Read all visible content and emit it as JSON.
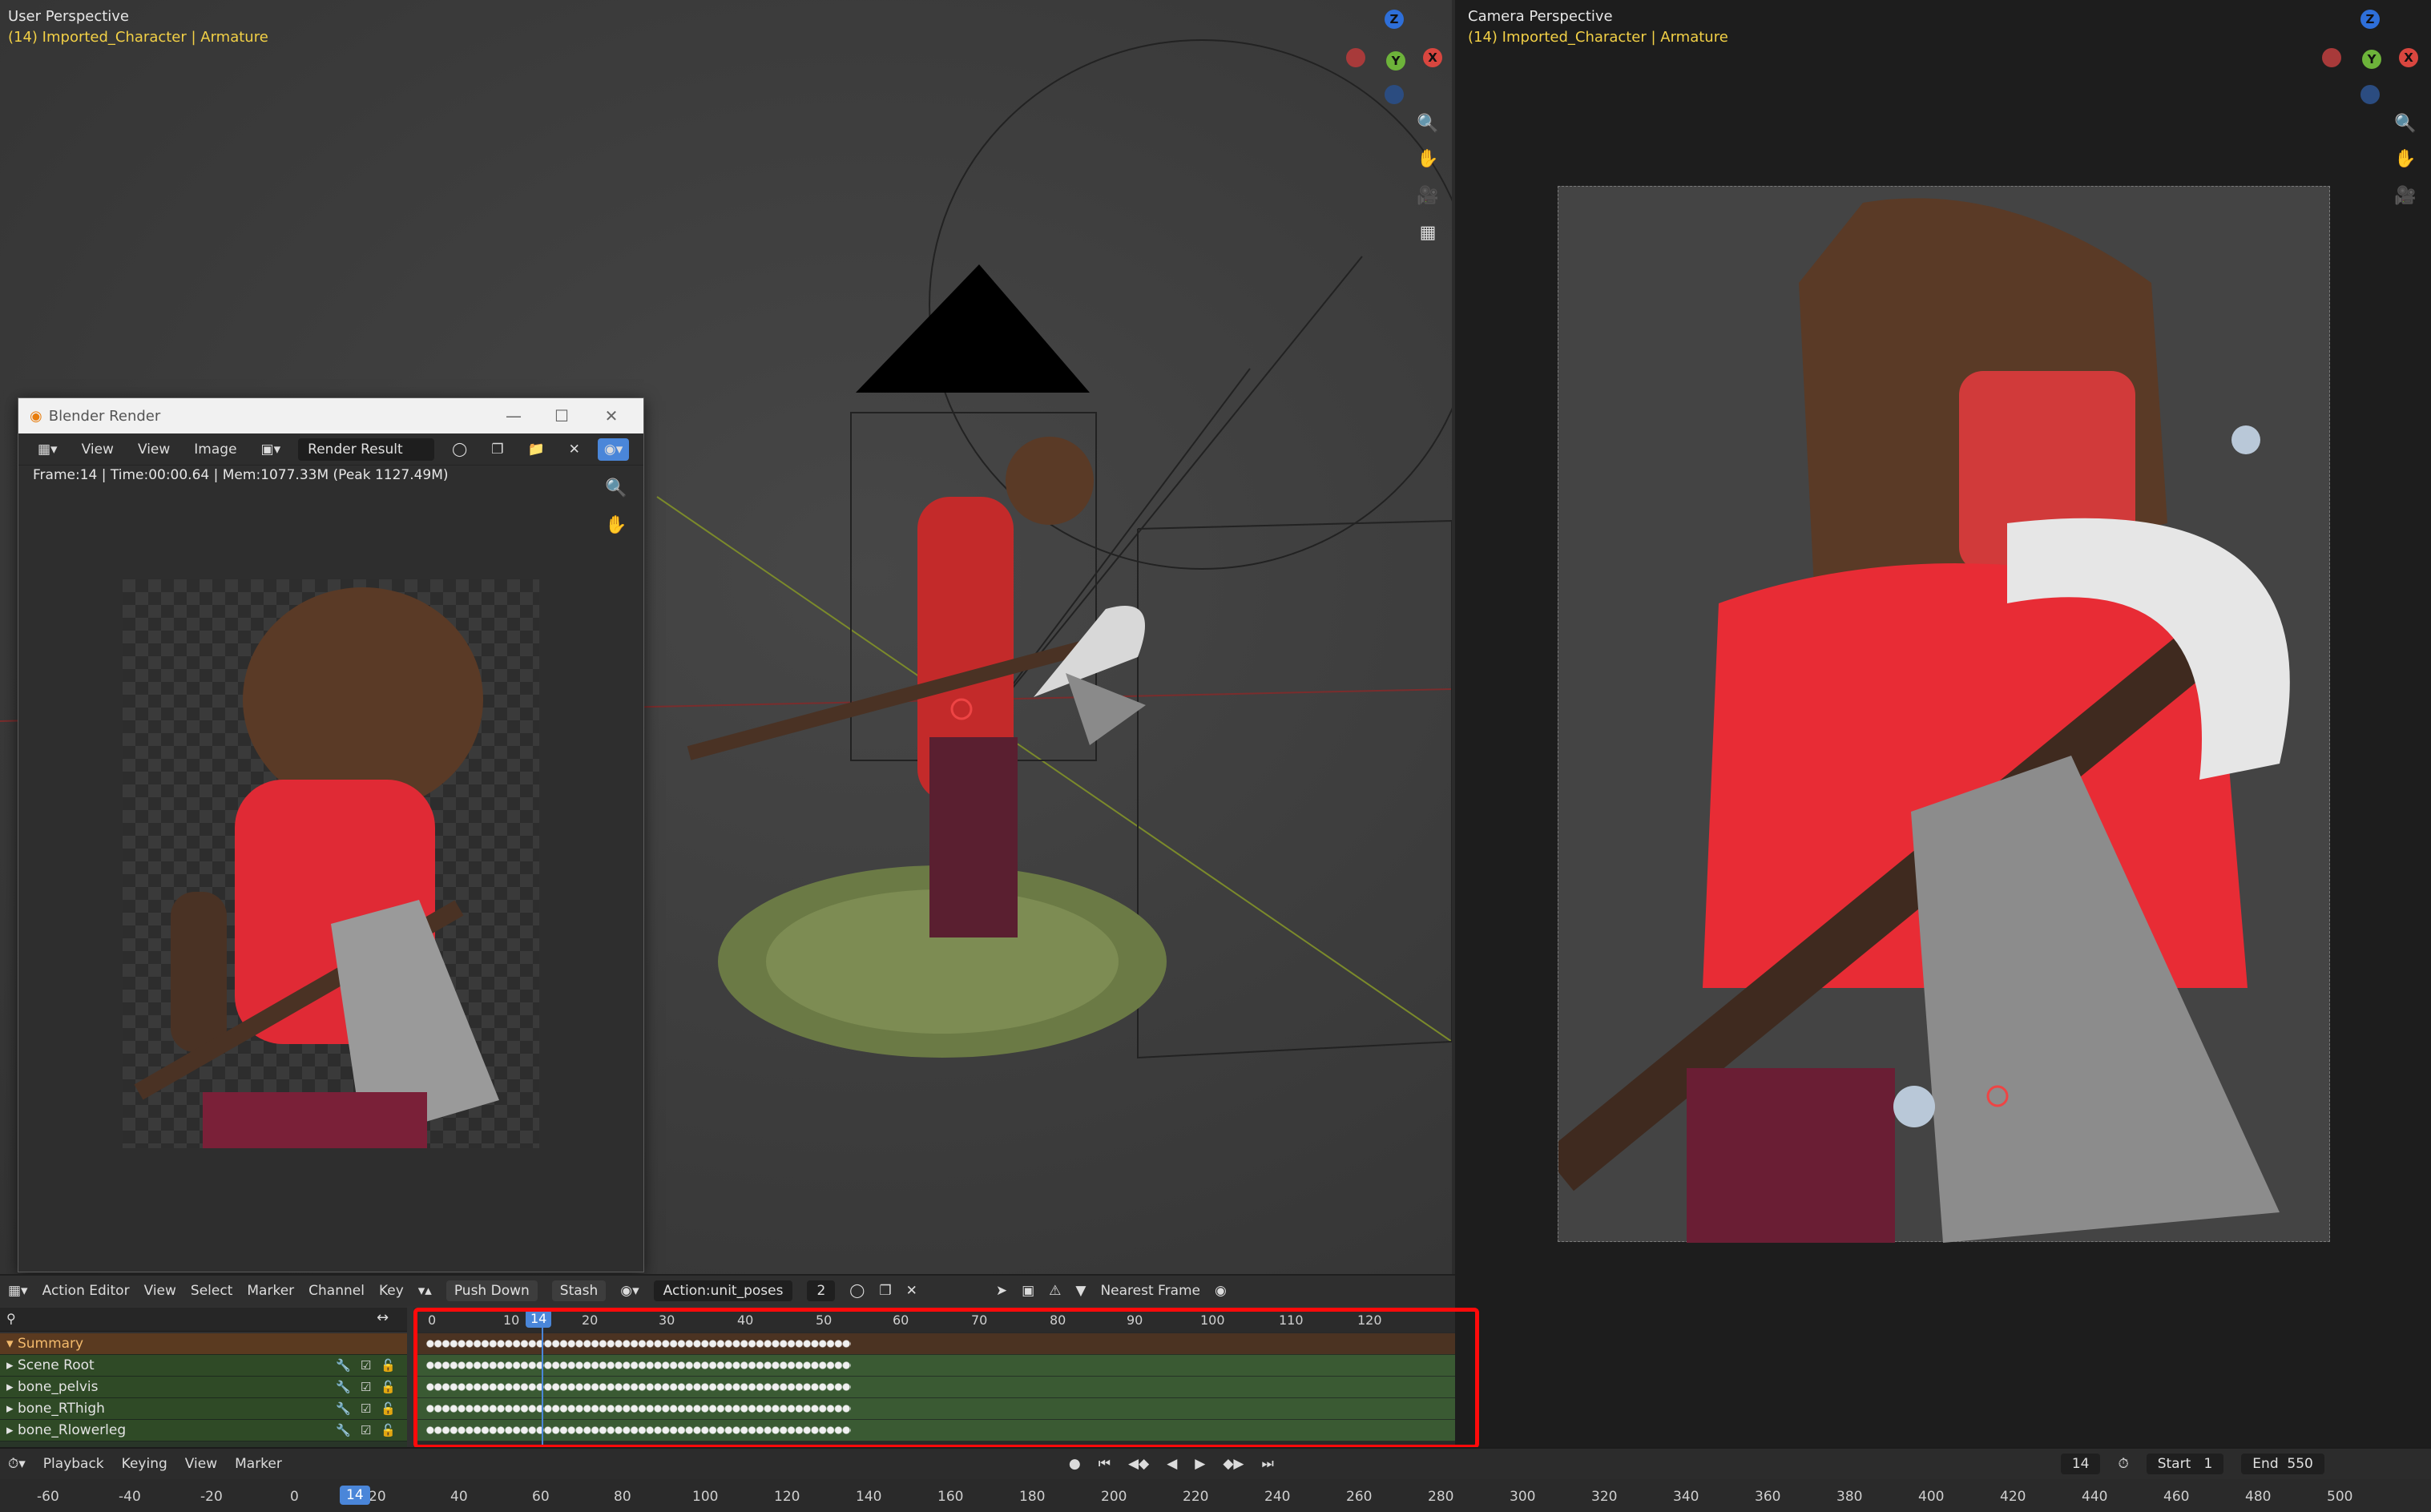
{
  "left_viewport": {
    "title": "User Perspective",
    "subtitle": "(14) Imported_Character | Armature"
  },
  "right_viewport": {
    "title": "Camera Perspective",
    "subtitle": "(14) Imported_Character | Armature"
  },
  "gizmo": {
    "z_label": "Z",
    "y_label": "Y",
    "x_label": "X"
  },
  "icons": [
    "zoom-icon",
    "hand-pan-icon",
    "camera-icon",
    "grid-icon"
  ],
  "render_window": {
    "title": "Blender Render",
    "menus": [
      "View",
      "Image"
    ],
    "image_name": "Render Result",
    "info": "Frame:14 | Time:00:00.64 | Mem:1077.33M (Peak 1127.49M)"
  },
  "action_editor": {
    "editor_type": "Action Editor",
    "menus": [
      "View",
      "Select",
      "Marker",
      "Channel",
      "Key"
    ],
    "push_down": "Push Down",
    "stash": "Stash",
    "action_name": "Action:unit_poses",
    "users": "2",
    "snap": "Nearest Frame",
    "channels": [
      "Summary",
      "Scene Root",
      "bone_pelvis",
      "bone_RThigh",
      "bone_Rlowerleg"
    ],
    "ruler": [
      "0",
      "10",
      "20",
      "30",
      "40",
      "50",
      "60",
      "70",
      "80",
      "90",
      "100",
      "110",
      "120"
    ],
    "current_frame": "14"
  },
  "timeline": {
    "menus": [
      "Playback",
      "Keying",
      "View",
      "Marker"
    ],
    "current_frame": "14",
    "start_label": "Start",
    "start_value": "1",
    "end_label": "End",
    "end_value": "550",
    "ruler": [
      "-60",
      "-40",
      "-20",
      "0",
      "20",
      "40",
      "60",
      "80",
      "100",
      "120",
      "140",
      "160",
      "180",
      "200",
      "220",
      "240",
      "260",
      "280",
      "300",
      "320",
      "340",
      "360",
      "380",
      "400",
      "420",
      "440",
      "460",
      "480",
      "500"
    ]
  }
}
